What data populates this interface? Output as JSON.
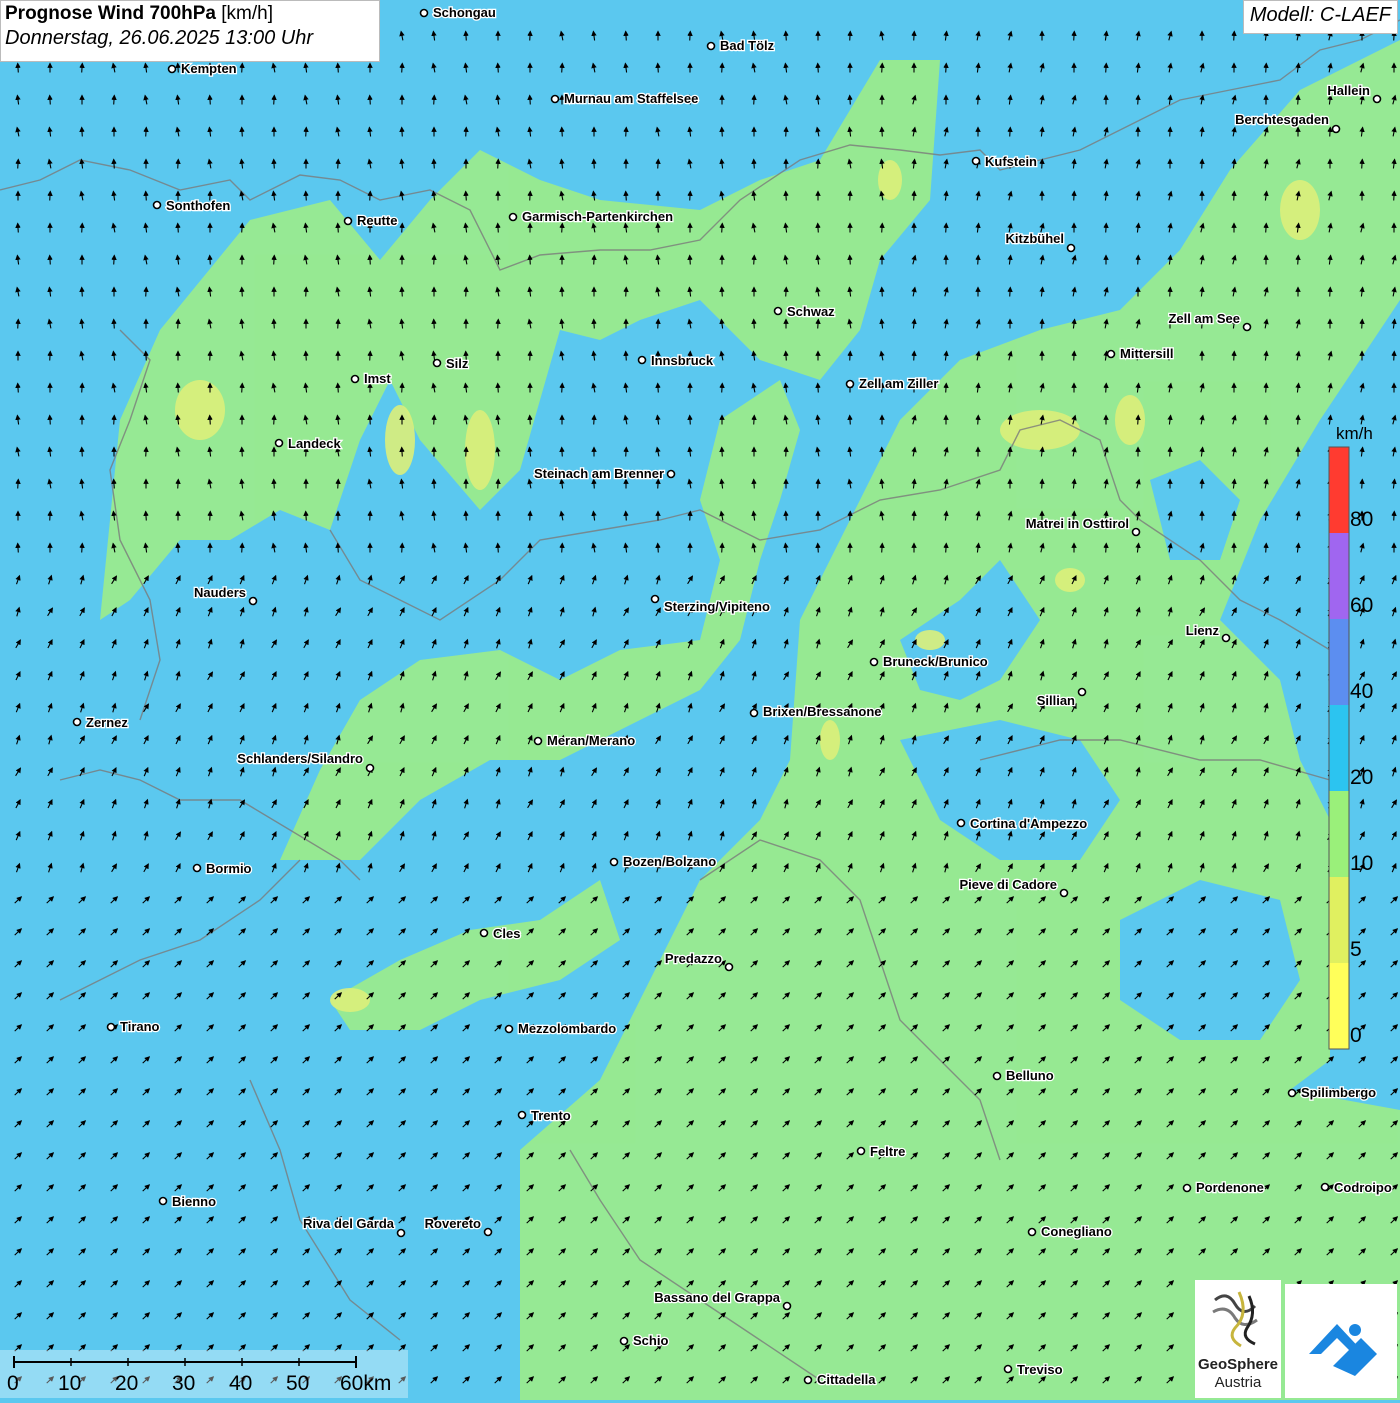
{
  "title": {
    "main_bold": "Prognose Wind 700hPa",
    "unit": "[km/h]",
    "datetime": "Donnerstag, 26.06.2025 13:00 Uhr"
  },
  "model": "Modell: C-LAEF",
  "legend": {
    "unit": "km/h",
    "labels": [
      "80",
      "60",
      "40",
      "20",
      "10",
      "5",
      "0"
    ],
    "colors": [
      "#ff3b30",
      "#a066f0",
      "#5c8ef0",
      "#2cc4f0",
      "#9af07a",
      "#e0f060",
      "#ffff5a"
    ]
  },
  "scale_bar": {
    "labels": [
      "0",
      "10",
      "20",
      "30",
      "40",
      "50",
      "60km"
    ]
  },
  "logos": {
    "geosphere_line1": "GeoSphere",
    "geosphere_line2": "Austria"
  },
  "cities": [
    "Schongau",
    "Bad Tölz",
    "Kempten",
    "Murnau am Staffelsee",
    "Hallein",
    "Berchtesgaden",
    "Kufstein",
    "Sonthofen",
    "Reutte",
    "Garmisch-Partenkirchen",
    "Kitzbühel",
    "Schwaz",
    "Zell am See",
    "Imst",
    "Silz",
    "Innsbruck",
    "Mittersill",
    "Zell am Ziller",
    "Landeck",
    "Steinach am Brenner",
    "Matrei in Osttirol",
    "Nauders",
    "Sterzing/Vipiteno",
    "Lienz",
    "Bruneck/Brunico",
    "Sillian",
    "Zernez",
    "Brixen/Bressanone",
    "Meran/Merano",
    "Schlanders/Silandro",
    "Cortina d'Ampezzo",
    "Bozen/Bolzano",
    "Bormio",
    "Pieve di Cadore",
    "Cles",
    "Predazzo",
    "Tirano",
    "Mezzolombardo",
    "Belluno",
    "Spilimbergo",
    "Trento",
    "Feltre",
    "Pordenone",
    "Codroipo",
    "Bienno",
    "Riva del Garda",
    "Rovereto",
    "Conegliano",
    "Bassano del Grappa",
    "Schio",
    "Treviso",
    "Cittadella"
  ]
}
